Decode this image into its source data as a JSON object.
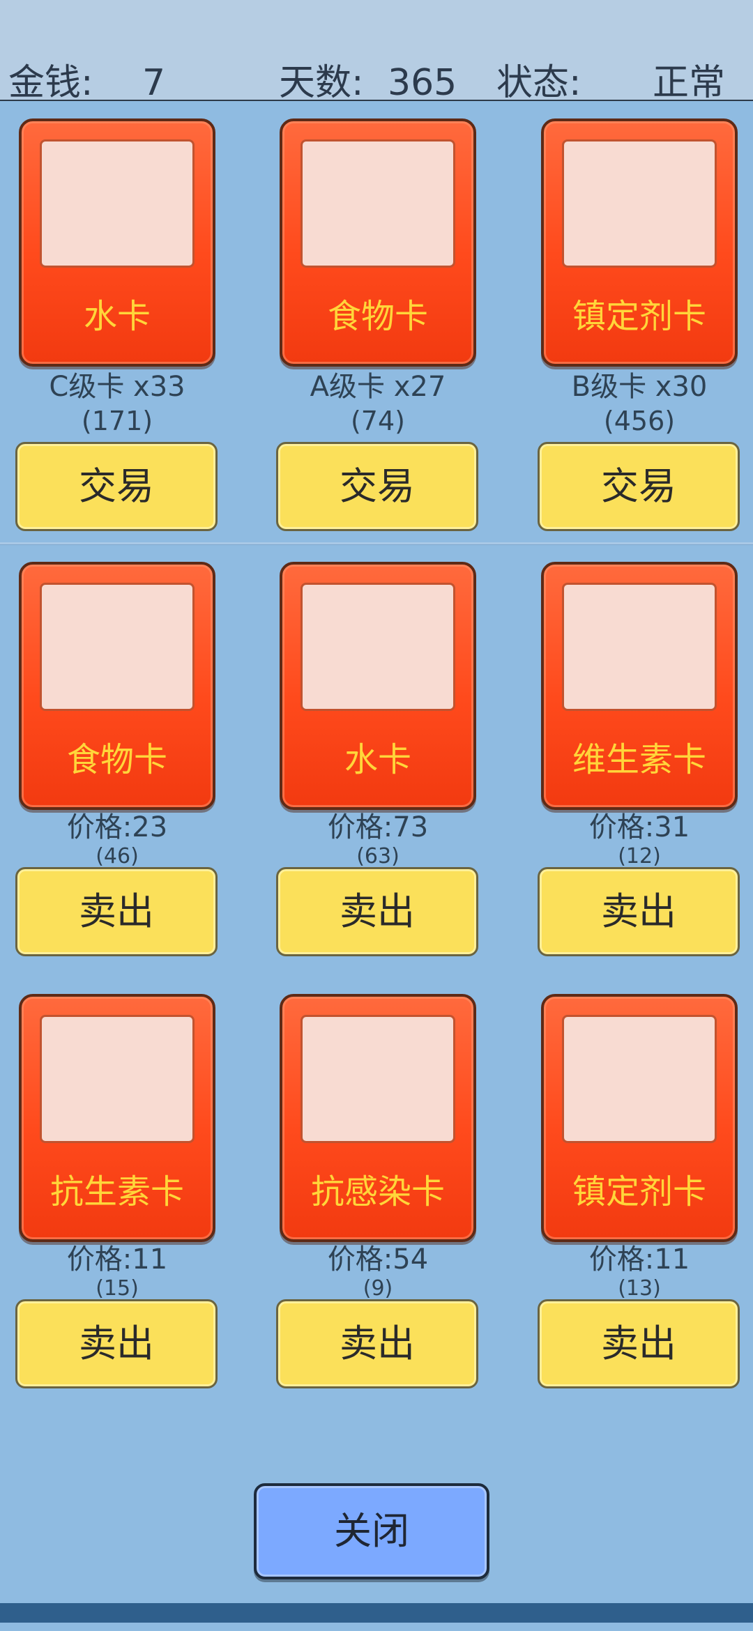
{
  "header": {
    "money_label": "金钱:",
    "money_value": "7",
    "days_label": "天数:",
    "days_value": "365",
    "status_label": "状态:",
    "status_value": "正常"
  },
  "trade_cards": [
    {
      "name": "水卡",
      "grade": "C级卡 x33",
      "sub": "(171)",
      "button": "交易"
    },
    {
      "name": "食物卡",
      "grade": "A级卡 x27",
      "sub": "(74)",
      "button": "交易"
    },
    {
      "name": "镇定剂卡",
      "grade": "B级卡 x30",
      "sub": "(456)",
      "button": "交易"
    }
  ],
  "sell_cards": [
    {
      "name": "食物卡",
      "price": "价格:23",
      "sub": "(46)",
      "button": "卖出"
    },
    {
      "name": "水卡",
      "price": "价格:73",
      "sub": "(63)",
      "button": "卖出"
    },
    {
      "name": "维生素卡",
      "price": "价格:31",
      "sub": "(12)",
      "button": "卖出"
    },
    {
      "name": "抗生素卡",
      "price": "价格:11",
      "sub": "(15)",
      "button": "卖出"
    },
    {
      "name": "抗感染卡",
      "price": "价格:54",
      "sub": "(9)",
      "button": "卖出"
    },
    {
      "name": "镇定剂卡",
      "price": "价格:11",
      "sub": "(13)",
      "button": "卖出"
    }
  ],
  "close_label": "关闭",
  "colors": {
    "background": "#8fbbe1",
    "card": "#ff4a1c",
    "card_text": "#ffd63a",
    "button": "#fbe05a",
    "close_button": "#7ca9ff"
  }
}
